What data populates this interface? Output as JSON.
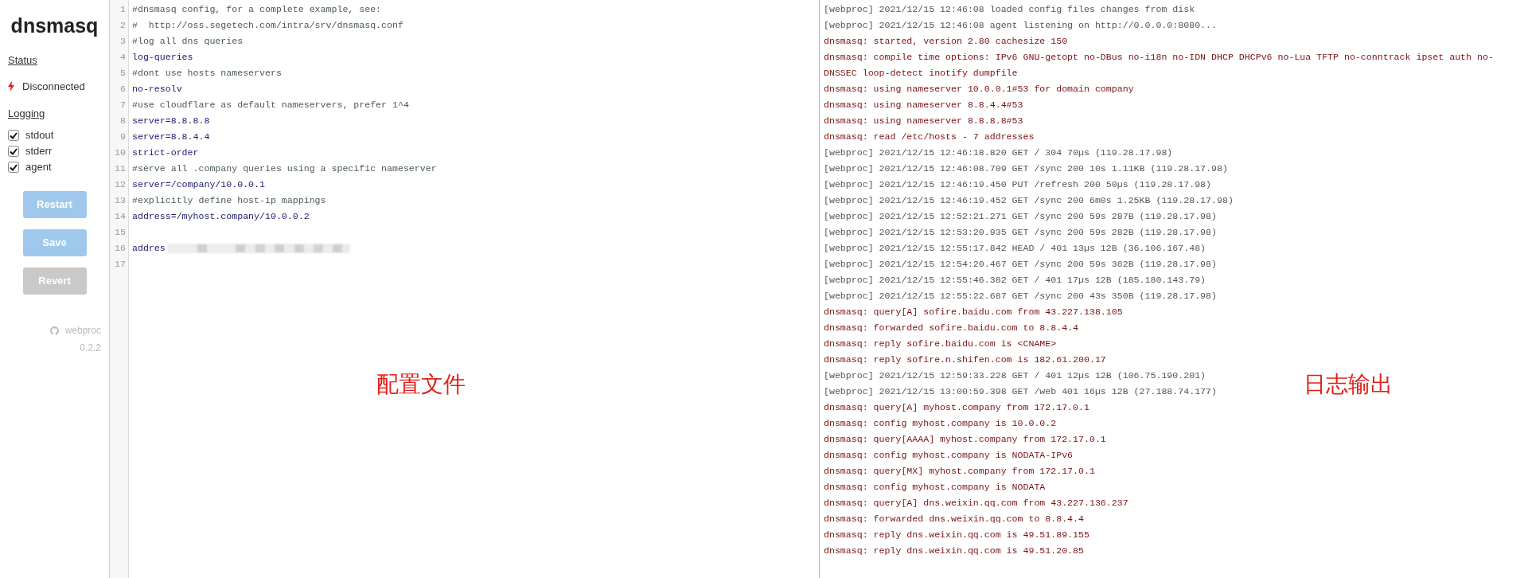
{
  "sidebar": {
    "title": "dnsmasq",
    "status_heading": "Status",
    "status": {
      "text": "Disconnected",
      "connected": false
    },
    "logging_heading": "Logging",
    "logging": [
      {
        "label": "stdout",
        "checked": true
      },
      {
        "label": "stderr",
        "checked": true
      },
      {
        "label": "agent",
        "checked": true
      }
    ],
    "buttons": [
      {
        "label": "Restart",
        "kind": "primary",
        "disabled": true
      },
      {
        "label": "Save",
        "kind": "primary",
        "disabled": true
      },
      {
        "label": "Revert",
        "kind": "secondary",
        "disabled": true
      }
    ],
    "footer": {
      "name": "webproc",
      "version": "0.2.2"
    }
  },
  "editor": {
    "annotation": "配置文件",
    "lines": [
      {
        "number": "1",
        "kind": "comment",
        "text": "#dnsmasq config, for a complete example, see:"
      },
      {
        "number": "2",
        "kind": "comment",
        "text": "#  http://oss.segetech.com/intra/srv/dnsmasq.conf"
      },
      {
        "number": "3",
        "kind": "comment",
        "text": "#log all dns queries"
      },
      {
        "number": "4",
        "kind": "setting",
        "text": "log-queries"
      },
      {
        "number": "5",
        "kind": "comment",
        "text": "#dont use hosts nameservers"
      },
      {
        "number": "6",
        "kind": "setting",
        "text": "no-resolv"
      },
      {
        "number": "7",
        "kind": "comment",
        "text": "#use cloudflare as default nameservers, prefer 1^4"
      },
      {
        "number": "8",
        "kind": "setting",
        "text": "server=8.8.8.8"
      },
      {
        "number": "9",
        "kind": "setting",
        "text": "server=8.8.4.4"
      },
      {
        "number": "10",
        "kind": "setting",
        "text": "strict-order"
      },
      {
        "number": "11",
        "kind": "comment",
        "text": "#serve all .company queries using a specific nameserver"
      },
      {
        "number": "12",
        "kind": "setting",
        "text": "server=/company/10.0.0.1"
      },
      {
        "number": "13",
        "kind": "comment",
        "text": "#explicitly define host-ip mappings"
      },
      {
        "number": "14",
        "kind": "setting",
        "text": "address=/myhost.company/10.0.0.2"
      },
      {
        "number": "15",
        "kind": "blank"
      },
      {
        "number": "16",
        "kind": "setting",
        "text": "addres",
        "redacted": true
      },
      {
        "number": "17",
        "kind": "blank"
      }
    ]
  },
  "log": {
    "annotation": "日志输出",
    "lines": [
      {
        "kind": "webproc",
        "text": "[webproc] 2021/12/15 12:46:08 loaded config files changes from disk"
      },
      {
        "kind": "webproc",
        "text": "[webproc] 2021/12/15 12:46:08 agent listening on http://0.0.0.0:8080..."
      },
      {
        "kind": "dnsmasq",
        "text": "dnsmasq: started, version 2.80 cachesize 150"
      },
      {
        "kind": "dnsmasq",
        "text": "dnsmasq: compile time options: IPv6 GNU-getopt no-DBus no-i18n no-IDN DHCP DHCPv6 no-Lua TFTP no-conntrack ipset auth no-DNSSEC loop-detect inotify dumpfile"
      },
      {
        "kind": "dnsmasq",
        "text": "dnsmasq: using nameserver 10.0.0.1#53 for domain company"
      },
      {
        "kind": "dnsmasq",
        "text": "dnsmasq: using nameserver 8.8.4.4#53"
      },
      {
        "kind": "dnsmasq",
        "text": "dnsmasq: using nameserver 8.8.8.8#53"
      },
      {
        "kind": "dnsmasq",
        "text": "dnsmasq: read /etc/hosts - 7 addresses"
      },
      {
        "kind": "webproc",
        "text": "[webproc] 2021/12/15 12:46:18.820 GET / 304 70µs (119.28.17.98)"
      },
      {
        "kind": "webproc",
        "text": "[webproc] 2021/12/15 12:46:08.709 GET /sync 200 10s 1.11KB (119.28.17.98)"
      },
      {
        "kind": "webproc",
        "text": "[webproc] 2021/12/15 12:46:19.450 PUT /refresh 200 50µs (119.28.17.98)"
      },
      {
        "kind": "webproc",
        "text": "[webproc] 2021/12/15 12:46:19.452 GET /sync 200 6m0s 1.25KB (119.28.17.98)"
      },
      {
        "kind": "webproc",
        "text": "[webproc] 2021/12/15 12:52:21.271 GET /sync 200 59s 287B (119.28.17.98)"
      },
      {
        "kind": "webproc",
        "text": "[webproc] 2021/12/15 12:53:20.935 GET /sync 200 59s 282B (119.28.17.98)"
      },
      {
        "kind": "webproc",
        "text": "[webproc] 2021/12/15 12:55:17.842 HEAD / 401 13µs 12B (36.106.167.48)"
      },
      {
        "kind": "webproc",
        "text": "[webproc] 2021/12/15 12:54:20.467 GET /sync 200 59s 362B (119.28.17.98)"
      },
      {
        "kind": "webproc",
        "text": "[webproc] 2021/12/15 12:55:46.382 GET / 401 17µs 12B (185.180.143.79)"
      },
      {
        "kind": "webproc",
        "text": "[webproc] 2021/12/15 12:55:22.687 GET /sync 200 43s 350B (119.28.17.98)"
      },
      {
        "kind": "dnsmasq",
        "text": "dnsmasq: query[A] sofire.baidu.com from 43.227.138.105"
      },
      {
        "kind": "dnsmasq",
        "text": "dnsmasq: forwarded sofire.baidu.com to 8.8.4.4"
      },
      {
        "kind": "dnsmasq",
        "text": "dnsmasq: reply sofire.baidu.com is <CNAME>"
      },
      {
        "kind": "dnsmasq",
        "text": "dnsmasq: reply sofire.n.shifen.com is 182.61.200.17"
      },
      {
        "kind": "webproc",
        "text": "[webproc] 2021/12/15 12:59:33.228 GET / 401 12µs 12B (106.75.190.201)"
      },
      {
        "kind": "webproc",
        "text": "[webproc] 2021/12/15 13:00:59.398 GET /web 401 16µs 12B (27.188.74.177)"
      },
      {
        "kind": "dnsmasq",
        "text": "dnsmasq: query[A] myhost.company from 172.17.0.1"
      },
      {
        "kind": "dnsmasq",
        "text": "dnsmasq: config myhost.company is 10.0.0.2"
      },
      {
        "kind": "dnsmasq",
        "text": "dnsmasq: query[AAAA] myhost.company from 172.17.0.1"
      },
      {
        "kind": "dnsmasq",
        "text": "dnsmasq: config myhost.company is NODATA-IPv6"
      },
      {
        "kind": "dnsmasq",
        "text": "dnsmasq: query[MX] myhost.company from 172.17.0.1"
      },
      {
        "kind": "dnsmasq",
        "text": "dnsmasq: config myhost.company is NODATA"
      },
      {
        "kind": "dnsmasq",
        "text": "dnsmasq: query[A] dns.weixin.qq.com from 43.227.136.237"
      },
      {
        "kind": "dnsmasq",
        "text": "dnsmasq: forwarded dns.weixin.qq.com to 8.8.4.4"
      },
      {
        "kind": "dnsmasq",
        "text": "dnsmasq: reply dns.weixin.qq.com is 49.51.89.155"
      },
      {
        "kind": "dnsmasq",
        "text": "dnsmasq: reply dns.weixin.qq.com is 49.51.20.85"
      }
    ]
  }
}
